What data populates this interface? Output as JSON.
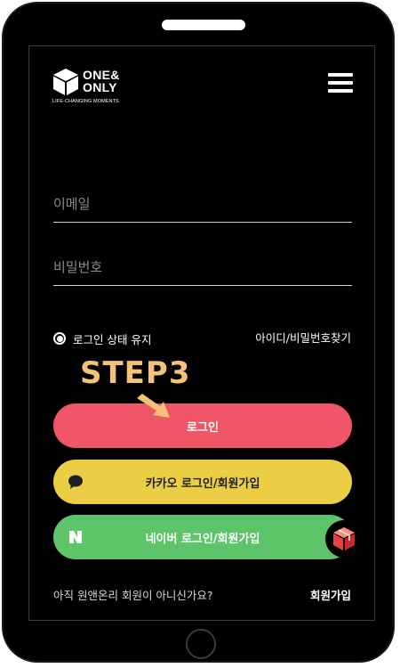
{
  "brand": {
    "name_line1": "ONE&",
    "name_line2": "ONLY",
    "tagline": "LIFE-CHANGING MOMENTS"
  },
  "icons": {
    "logo": "cube-logo-icon",
    "menu": "hamburger-menu-icon",
    "kakao": "speech-bubble-icon",
    "naver": "naver-n-icon",
    "badge": "red-cube-icon",
    "pointer": "arrow-pointer-icon"
  },
  "form": {
    "email_placeholder": "이메일",
    "password_placeholder": "비밀번호",
    "remember_label": "로그인 상태 유지",
    "remember_checked": true,
    "find_link": "아이디/비밀번호찾기"
  },
  "annotation": {
    "step_label": "STEP3"
  },
  "buttons": {
    "login": "로그인",
    "kakao": "카카오 로그인/회원가입",
    "naver": "네이버 로그인/회원가입"
  },
  "footer": {
    "question": "아직 원앤온리 회원이 아니신가요?",
    "signup": "회원가입"
  },
  "colors": {
    "login": "#ee5566",
    "kakao": "#ecce45",
    "naver": "#5ec46a",
    "step": "#f4c178"
  }
}
